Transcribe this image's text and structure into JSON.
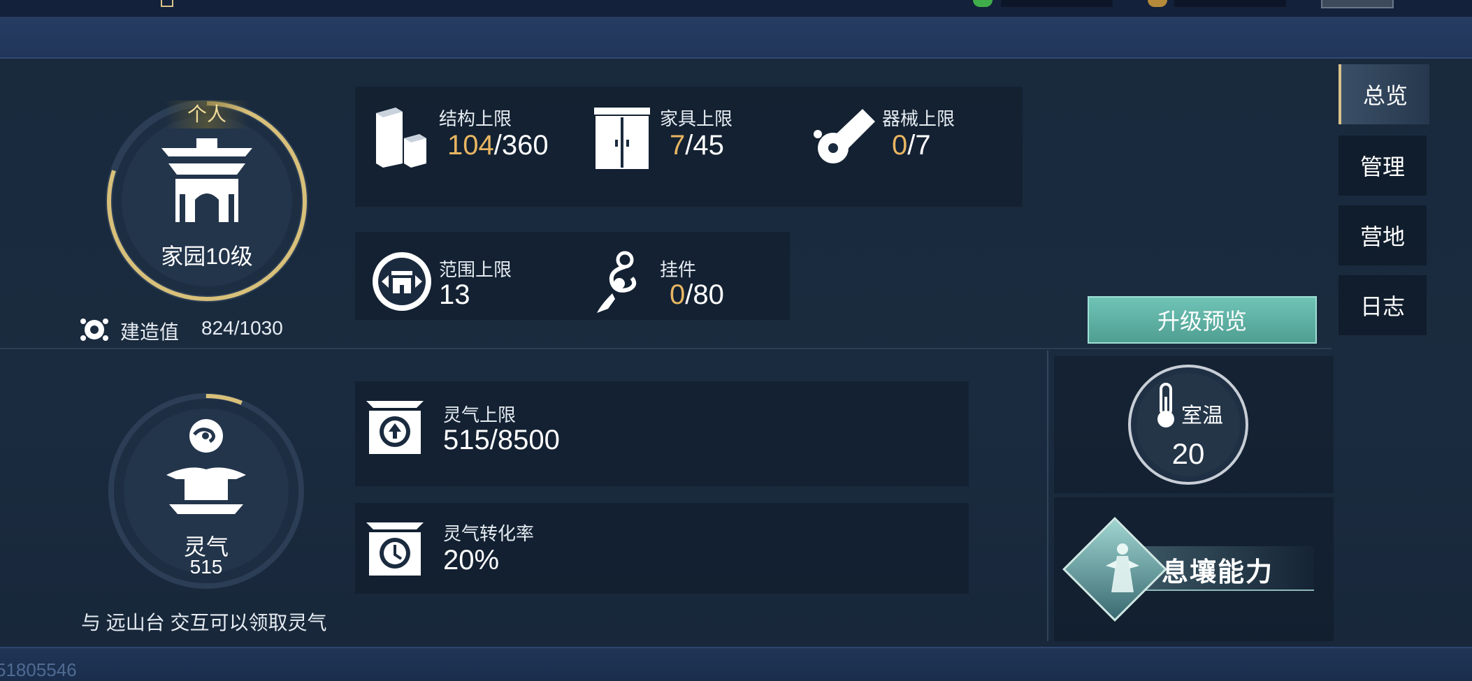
{
  "footer_id": "51805546",
  "tabs": [
    {
      "label": "总览",
      "active": true
    },
    {
      "label": "管理",
      "active": false
    },
    {
      "label": "营地",
      "active": false
    },
    {
      "label": "日志",
      "active": false
    }
  ],
  "home": {
    "badge": "个人",
    "name": "家园10级",
    "build_label": "建造值",
    "build_value": "824/1030",
    "build_progress": 0.8
  },
  "limits": {
    "structure": {
      "label": "结构上限",
      "current": "104",
      "max": "/360"
    },
    "furniture": {
      "label": "家具上限",
      "current": "7",
      "max": "/45"
    },
    "equipment": {
      "label": "器械上限",
      "current": "0",
      "max": "/7"
    },
    "range": {
      "label": "范围上限",
      "value": "13"
    },
    "pendant": {
      "label": "挂件",
      "current": "0",
      "max": "/80"
    }
  },
  "upgrade_button": "升级预览",
  "spirit": {
    "name": "灵气",
    "value": "515",
    "hint": "与 远山台 交互可以领取灵气",
    "progress": 0.06,
    "cap_label": "灵气上限",
    "cap_value": "515/8500",
    "rate_label": "灵气转化率",
    "rate_value": "20%"
  },
  "temperature": {
    "label": "室温",
    "value": "20"
  },
  "ability": {
    "label": "息壤能力"
  },
  "colors": {
    "accent_gold": "#e8b561",
    "button_teal": "#5fb3a6",
    "ring_gold": "#d8c07a"
  }
}
